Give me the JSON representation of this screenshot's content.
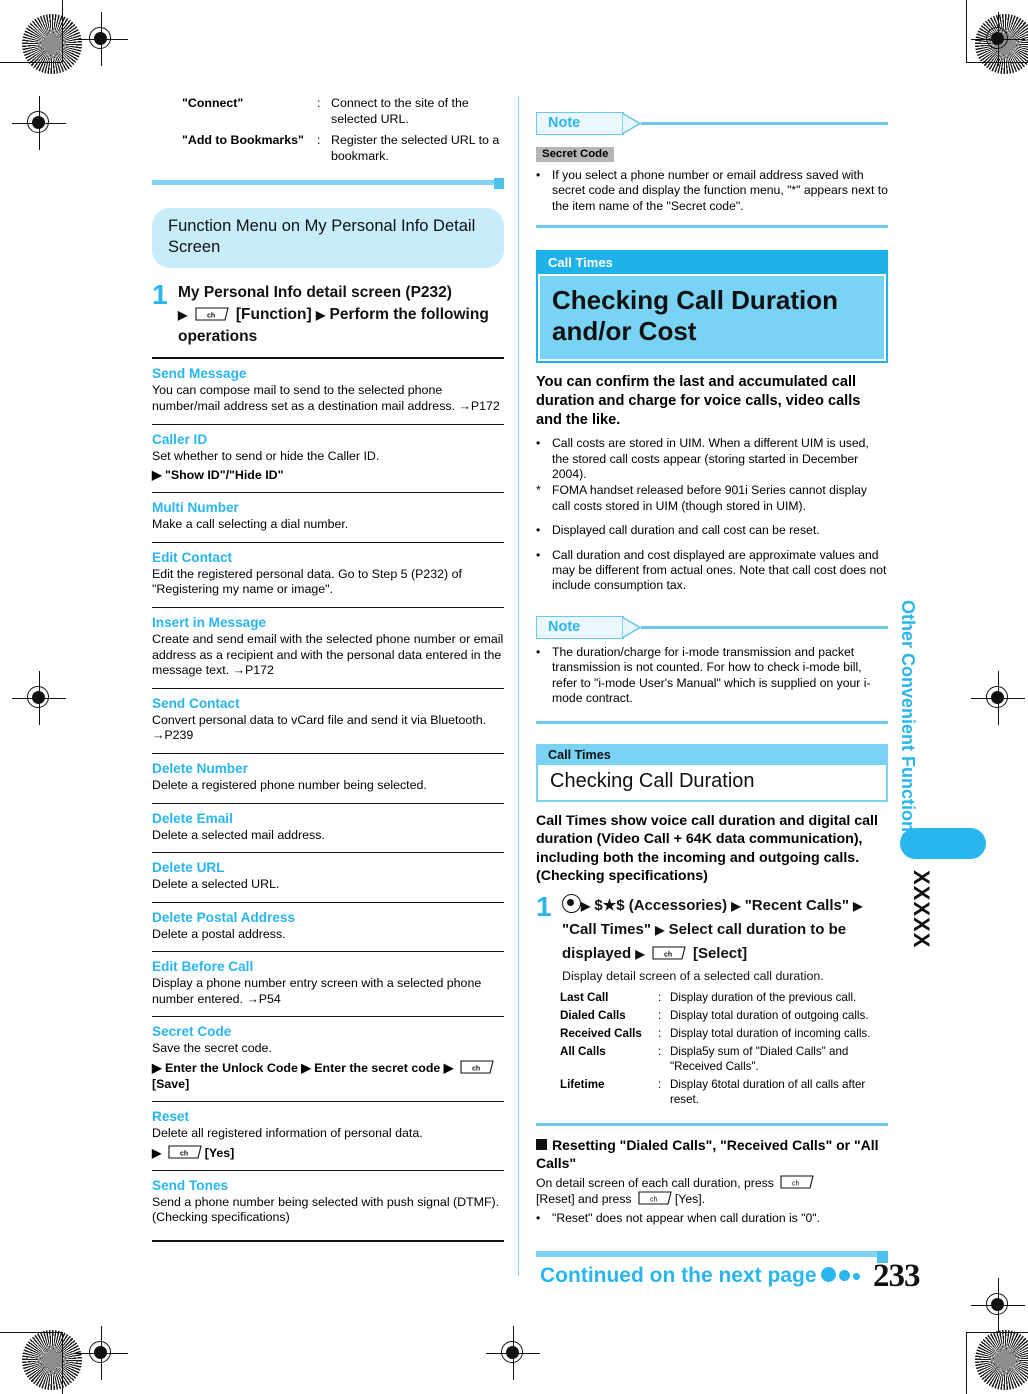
{
  "page": {
    "number": "233",
    "continued_label": "Continued on the next page",
    "chapter_tab": "Other Convenient Functions",
    "chapter_tab_code": "XXXXX"
  },
  "left": {
    "top_definitions": [
      {
        "term": "\"Connect\"",
        "colon": ":",
        "desc": "Connect to the site of the selected URL."
      },
      {
        "term": "\"Add to Bookmarks\"",
        "colon": ":",
        "desc": "Register the selected URL to a bookmark."
      }
    ],
    "section_banner": "Function Menu on My Personal Info Detail Screen",
    "step": {
      "number": "1",
      "line1": "My Personal Info detail screen (P232)",
      "arrow1": "▶",
      "key1": "ch",
      "label1": "[Function]",
      "arrow2": "▶",
      "line2": "Perform the following operations"
    },
    "items": [
      {
        "title": "Send Message",
        "body": "You can compose mail to send to the selected phone number/mail address set as a destination mail address. →P172",
        "sub": ""
      },
      {
        "title": "Caller ID",
        "body": "Set whether to send or hide the Caller ID.",
        "sub": "▶ \"Show ID\"/\"Hide ID\""
      },
      {
        "title": "Multi Number",
        "body": "Make a call selecting a dial number.",
        "sub": ""
      },
      {
        "title": "Edit Contact",
        "body": "Edit the registered personal data. Go to Step 5 (P232) of \"Registering my name or image\".",
        "sub": ""
      },
      {
        "title": "Insert in Message",
        "body": "Create and send email with the selected phone number or email address as a recipient and with the personal data entered in the message text. →P172",
        "sub": ""
      },
      {
        "title": "Send Contact",
        "body": "Convert personal data to vCard file and send it via Bluetooth. →P239",
        "sub": ""
      },
      {
        "title": "Delete Number",
        "body": "Delete a registered phone number being selected.",
        "sub": ""
      },
      {
        "title": "Delete Email",
        "body": "Delete a selected mail address.",
        "sub": ""
      },
      {
        "title": "Delete URL",
        "body": "Delete a selected URL.",
        "sub": ""
      },
      {
        "title": "Delete Postal Address",
        "body": "Delete a postal address.",
        "sub": ""
      },
      {
        "title": "Edit Before Call",
        "body": "Display a phone number entry screen with a selected phone number entered. →P54",
        "sub": ""
      }
    ],
    "secret_code_item": {
      "title": "Secret Code",
      "body": "Save the secret code.",
      "sub_a": "▶ Enter the Unlock Code ▶ Enter the secret code ▶",
      "key": "ch",
      "sub_b": "[Save]"
    },
    "reset_item": {
      "title": "Reset",
      "body": "Delete all registered information of personal data.",
      "arrow": "▶",
      "key": "ch",
      "label": "[Yes]"
    },
    "send_tones_item": {
      "title": "Send Tones",
      "body": "Send a phone number being selected with push signal (DTMF). (Checking specifications)"
    }
  },
  "right": {
    "note1": {
      "tag": "Note",
      "grey_label": "Secret Code",
      "bullets": [
        {
          "mark": "•",
          "text": "If you select a phone number or email address saved with secret code and display the function menu, \"*\" appears next to the item name of the \"Secret code\"."
        }
      ]
    },
    "chapter": {
      "tag": "Call Times",
      "title": "Checking Call Duration and/or Cost"
    },
    "lead": "You can confirm the last and accumulated call duration and charge for voice calls, video calls and the like.",
    "lead_bullets": [
      {
        "mark": "•",
        "text": "Call costs are stored in UIM. When a different UIM is used, the stored call costs appear (storing started in December 2004)."
      },
      {
        "mark": "*",
        "text": "FOMA handset released before 901i Series cannot display call costs stored in UIM (though stored in UIM)."
      },
      {
        "mark": "•",
        "text": "Displayed call duration and call cost can be reset."
      },
      {
        "mark": "•",
        "text": "Call duration and cost displayed are approximate values and may be different from actual ones. Note that call cost does not include consumption tax."
      }
    ],
    "note2": {
      "tag": "Note",
      "bullets": [
        {
          "mark": "•",
          "text": "The duration/charge for i-mode transmission and packet transmission is not counted. For how to check i-mode bill, refer to \"i-mode User's Manual\" which is supplied on your i-mode contract."
        }
      ]
    },
    "subchapter": {
      "tag": "Call Times",
      "title": "Checking Call Duration"
    },
    "sub_lead": "Call Times show voice call duration and digital call duration (Video Call + 64K data communication), including both the incoming and outgoing calls. (Checking specifications)",
    "step": {
      "number": "1",
      "seg1": "(Accessories)",
      "seg2": "\"Recent Calls\"",
      "seg3": "\"Call Times\"",
      "seg4": "Select call duration to be displayed",
      "key": "ch",
      "seg5": "[Select]",
      "accessories_glyph": "$★$",
      "note": "Display detail screen of a selected call duration."
    },
    "mini_table": [
      {
        "term": "Last Call",
        "colon": ":",
        "desc": "Display duration of the previous call."
      },
      {
        "term": "Dialed Calls",
        "colon": ":",
        "desc": "Display total duration of outgoing calls."
      },
      {
        "term": "Received Calls",
        "colon": ":",
        "desc": "Display total duration of incoming calls."
      },
      {
        "term": "All Calls",
        "colon": ":",
        "desc": "Displa5y sum of \"Dialed Calls\" and \"Received Calls\"."
      },
      {
        "term": "Lifetime",
        "colon": ":",
        "desc": "Display 6total duration of all calls after reset."
      }
    ],
    "subsection": {
      "title": "Resetting \"Dialed Calls\", \"Received Calls\" or \"All Calls\"",
      "body_a": "On detail screen of each call duration, press",
      "key1": "ch",
      "body_b": "[Reset] and press",
      "key2": "ch",
      "body_c": "[Yes].",
      "bullet": {
        "mark": "•",
        "text": "\"Reset\" does not appear when call duration is \"0\"."
      }
    }
  },
  "colors": {
    "accent_blue": "#29b6ef",
    "light_blue": "#7fd4f5",
    "pale_blue": "#c7ecfa",
    "header_blue": "#1fb2ea",
    "mid_blue": "#79d3f4"
  }
}
